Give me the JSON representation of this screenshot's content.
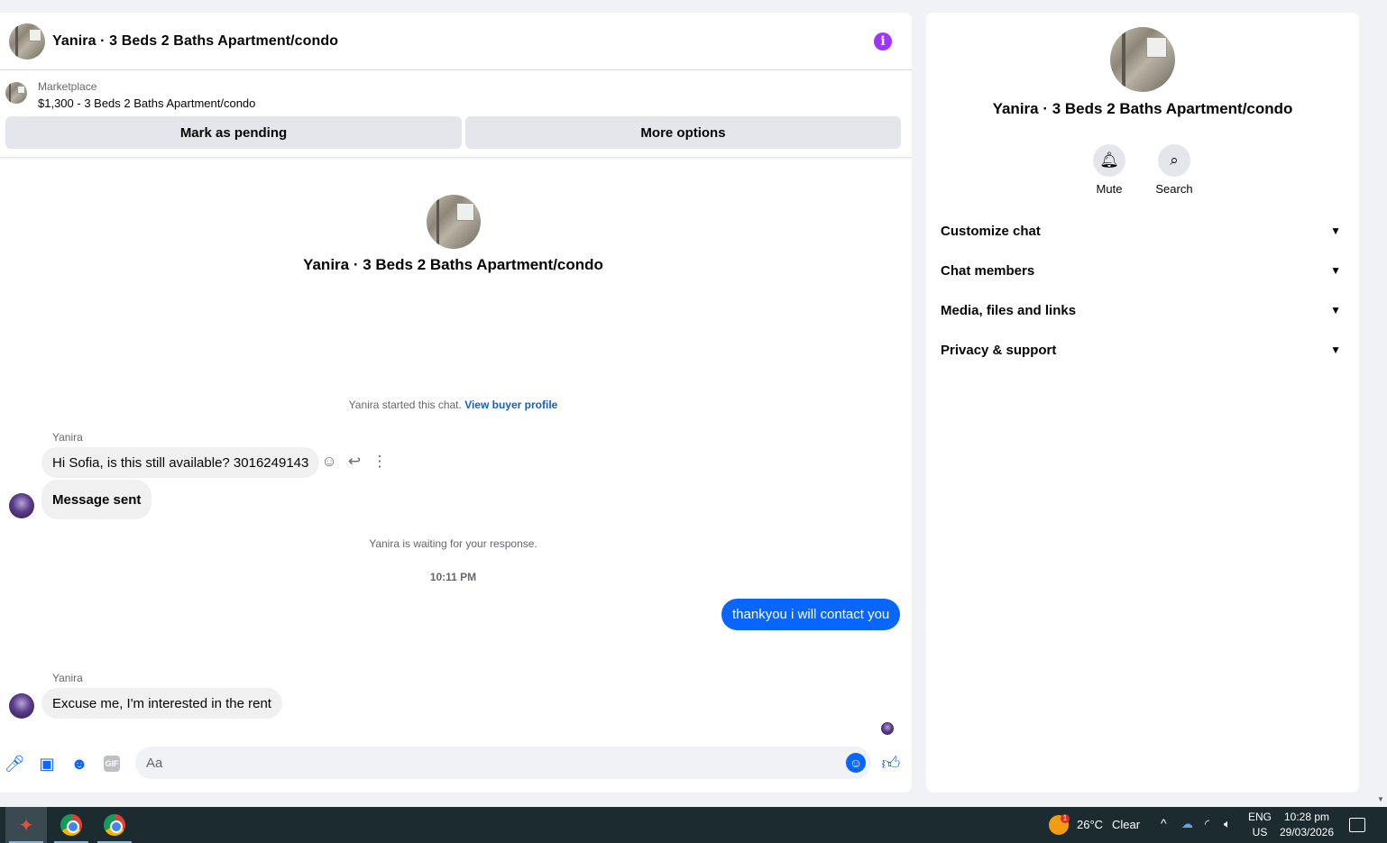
{
  "chat": {
    "header_title": "Yanira · 3 Beds 2 Baths Apartment/condo",
    "info_icon": "i",
    "marketplace_label": "Marketplace",
    "listing": "$1,300 - 3 Beds 2 Baths Apartment/condo",
    "mark_pending": "Mark as pending",
    "more_options": "More options",
    "intro_title": "Yanira · 3 Beds 2 Baths Apartment/condo",
    "started_text": "Yanira started this chat.",
    "view_profile": "View buyer profile",
    "sender1": "Yanira",
    "msg1": "Hi Sofia, is this still available? 3016249143",
    "msg2": "Message sent",
    "waiting": "Yanira is waiting for your response.",
    "time": "10:11 PM",
    "msg_out": "thankyou i will contact you",
    "sender2": "Yanira",
    "msg3": "Excuse me, I'm interested in the rent",
    "placeholder": "Aa"
  },
  "info_panel": {
    "title": "Yanira · 3 Beds 2 Baths Apartment/condo",
    "mute": "Mute",
    "search": "Search",
    "rows": [
      "Customize chat",
      "Chat members",
      "Media, files and links",
      "Privacy & support"
    ]
  },
  "taskbar": {
    "weather_temp": "26°C",
    "weather_desc": "Clear",
    "lang": "ENG",
    "region": "US",
    "time": "10:28 pm",
    "date": "29/03/2026",
    "weather_badge": "1"
  },
  "colors": {
    "accent": "#0866ff",
    "info": "#a033ff",
    "link": "#1a5fb4"
  }
}
